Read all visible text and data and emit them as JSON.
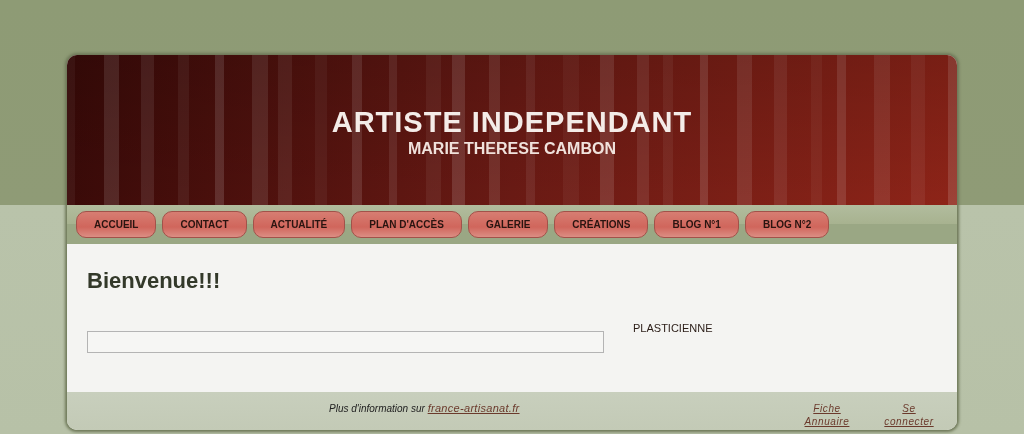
{
  "header": {
    "title": "ARTISTE INDEPENDANT",
    "subtitle": "MARIE THERESE CAMBON"
  },
  "nav": [
    {
      "label": "ACCUEIL"
    },
    {
      "label": "CONTACT"
    },
    {
      "label": "ACTUALITÉ"
    },
    {
      "label": "PLAN D'ACCÈS"
    },
    {
      "label": "GALERIE"
    },
    {
      "label": "CRÉATIONS"
    },
    {
      "label": "BLOG N°1"
    },
    {
      "label": "BLOG N°2"
    }
  ],
  "content": {
    "heading": "Bienvenue!!!",
    "side_text": "PLASTICIENNE"
  },
  "footer": {
    "info_text": "Plus d'information sur",
    "info_link": "france-artisanat.fr",
    "links": [
      "Fiche Annuaire",
      "Se connecter"
    ]
  }
}
